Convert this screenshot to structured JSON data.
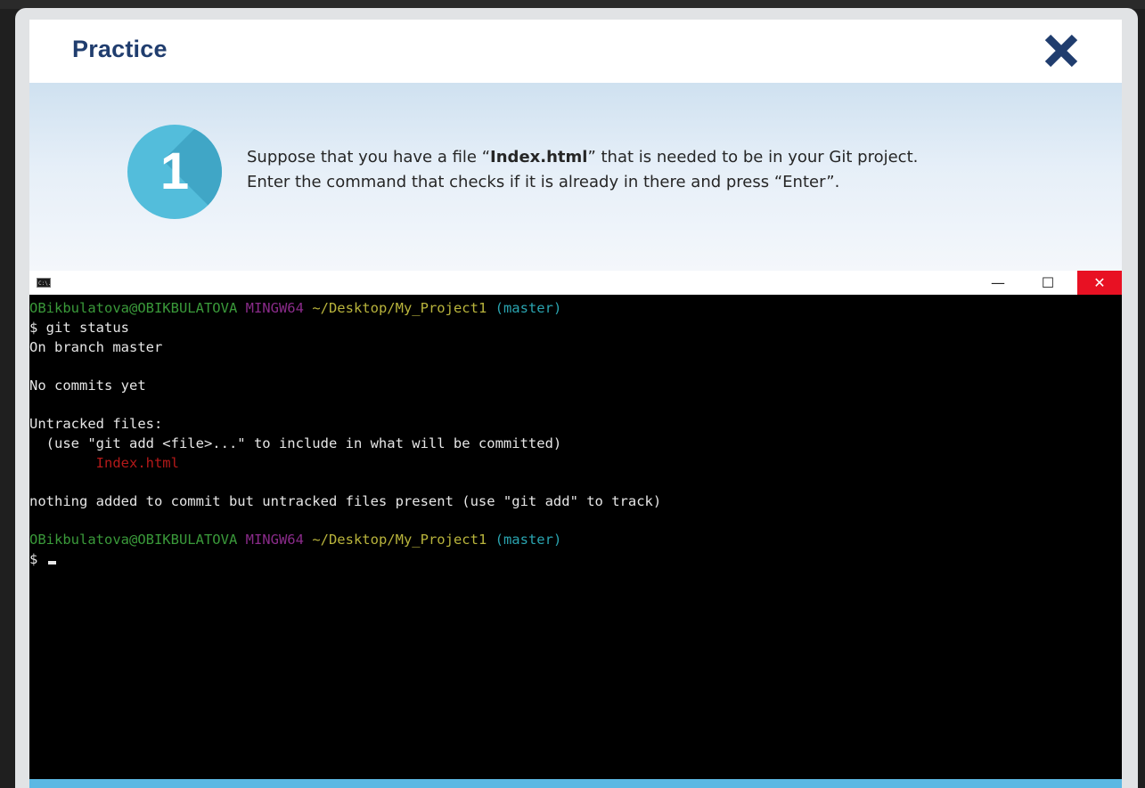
{
  "header": {
    "title": "Practice",
    "close_icon": "close-icon"
  },
  "task": {
    "step_number": "1",
    "line1_prefix": "Suppose that you have a file “",
    "line1_file": "Index.html",
    "line1_suffix": "” that is needed to be in your Git project.",
    "line2": "Enter the command that checks if it is already in there and press “Enter”."
  },
  "terminal_window": {
    "icon": "C:\\.",
    "minimize": "—",
    "maximize": "☐",
    "close": "✕"
  },
  "terminal": {
    "prompt1": {
      "user": "OBikbulatova@OBIKBULATOVA",
      "env": "MINGW64",
      "path": "~/Desktop/My_Project1",
      "branch": "(master)"
    },
    "command": "$ git status",
    "out1": "On branch master",
    "out2": "No commits yet",
    "out3": "Untracked files:",
    "out4": "  (use \"git add <file>...\" to include in what will be committed)",
    "out5": "        Index.html",
    "out6": "nothing added to commit but untracked files present (use \"git add\" to track)",
    "prompt2": {
      "user": "OBikbulatova@OBIKBULATOVA",
      "env": "MINGW64",
      "path": "~/Desktop/My_Project1",
      "branch": "(master)"
    },
    "input_prompt": "$ "
  },
  "colors": {
    "title": "#203d6e",
    "badge": "#53bddb",
    "close_red": "#e81123",
    "bottom_bar": "#5bb8e3"
  }
}
